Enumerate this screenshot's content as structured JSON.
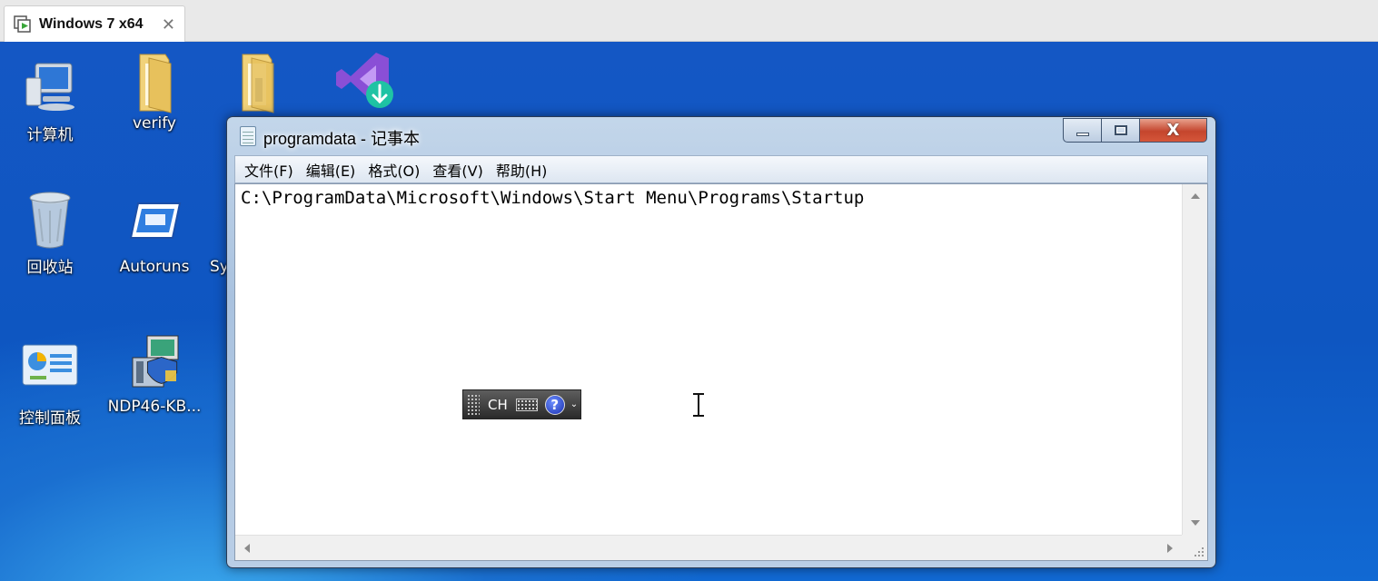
{
  "vm_tab": {
    "title": "Windows 7 x64",
    "close_glyph": "✕"
  },
  "desktop_icons": [
    {
      "label": "计算机",
      "icon": "computer-icon"
    },
    {
      "label": "verify",
      "icon": "folder-icon"
    },
    {
      "label": "",
      "icon": "folder-icon"
    },
    {
      "label": "",
      "icon": "visual-studio-installer-icon"
    },
    {
      "label": "回收站",
      "icon": "recycle-bin-icon"
    },
    {
      "label": "Autoruns",
      "icon": "autoruns-icon"
    },
    {
      "label": "Sy",
      "icon": "app-icon"
    },
    {
      "label": "控制面板",
      "icon": "control-panel-icon"
    },
    {
      "label": "NDP46-KB...",
      "icon": "installer-icon"
    }
  ],
  "notepad": {
    "title": "programdata - 记事本",
    "controls": {
      "close_glyph": "X"
    },
    "menu": [
      "文件(F)",
      "编辑(E)",
      "格式(O)",
      "查看(V)",
      "帮助(H)"
    ],
    "content": "C:\\ProgramData\\Microsoft\\Windows\\Start Menu\\Programs\\Startup"
  },
  "language_bar": {
    "lang": "CH",
    "help_glyph": "?",
    "options_glyph": "⌄"
  },
  "colors": {
    "desktop_blue": "#1457c4",
    "close_red": "#c4452d",
    "vs_purple": "#8a4fd6",
    "vs_badge_green": "#1fc3a4"
  }
}
